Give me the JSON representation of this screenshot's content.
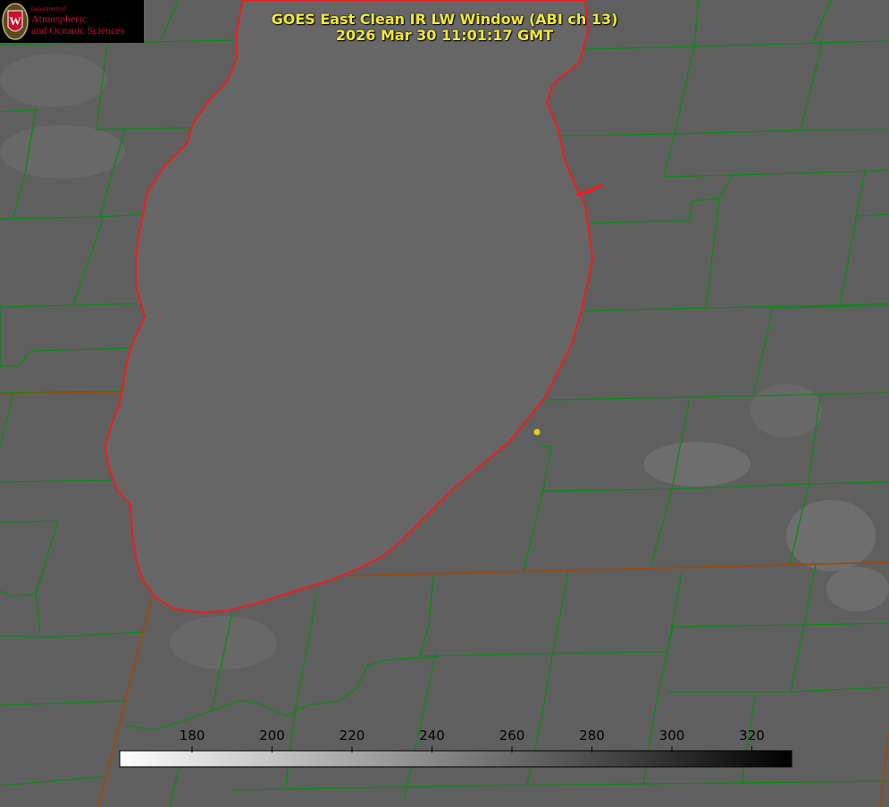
{
  "header": {
    "title_line1": "GOES East Clean IR LW Window (ABI ch 13)",
    "title_line2": "2026 Mar 30 11:01:17 GMT"
  },
  "logo": {
    "department": "Department of",
    "org_line1": "Atmospheric",
    "org_line2": "and Oceanic Sciences",
    "seal_letter": "W"
  },
  "colorbar": {
    "tick_labels": [
      "180",
      "200",
      "220",
      "240",
      "260",
      "280",
      "300",
      "320"
    ],
    "gradient_start": "#ffffff",
    "gradient_end": "#000000"
  },
  "map": {
    "background_color": "#5f5f5f",
    "lake_color": "#666666",
    "county_line_color": "#0a8a14",
    "shoreline_color": "#ee1c1c",
    "state_line_color": "#9a4a10",
    "marker_color": "#e0d020"
  }
}
